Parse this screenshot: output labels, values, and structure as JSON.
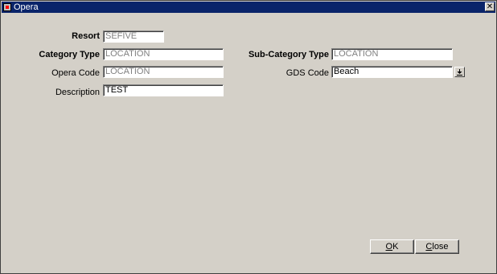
{
  "window": {
    "title": "Opera",
    "close_glyph": "✕"
  },
  "form": {
    "resort": {
      "label": "Resort",
      "value": "SEFIVE"
    },
    "category_type": {
      "label": "Category Type",
      "value": "LOCATION"
    },
    "opera_code": {
      "label": "Opera Code",
      "value": "LOCATION"
    },
    "description": {
      "label": "Description",
      "value": "TEST"
    },
    "sub_category_type": {
      "label": "Sub-Category Type",
      "value": "LOCATION"
    },
    "gds_code": {
      "label": "GDS Code",
      "value": "Beach",
      "dropdown_icon": "down-arrow-icon"
    }
  },
  "buttons": {
    "ok": {
      "mnemonic": "O",
      "rest": "K"
    },
    "close": {
      "mnemonic": "C",
      "rest": "lose"
    }
  },
  "colors": {
    "title_bar": "#0a246a",
    "window_bg": "#d4d0c8",
    "disabled_text": "#808080"
  }
}
